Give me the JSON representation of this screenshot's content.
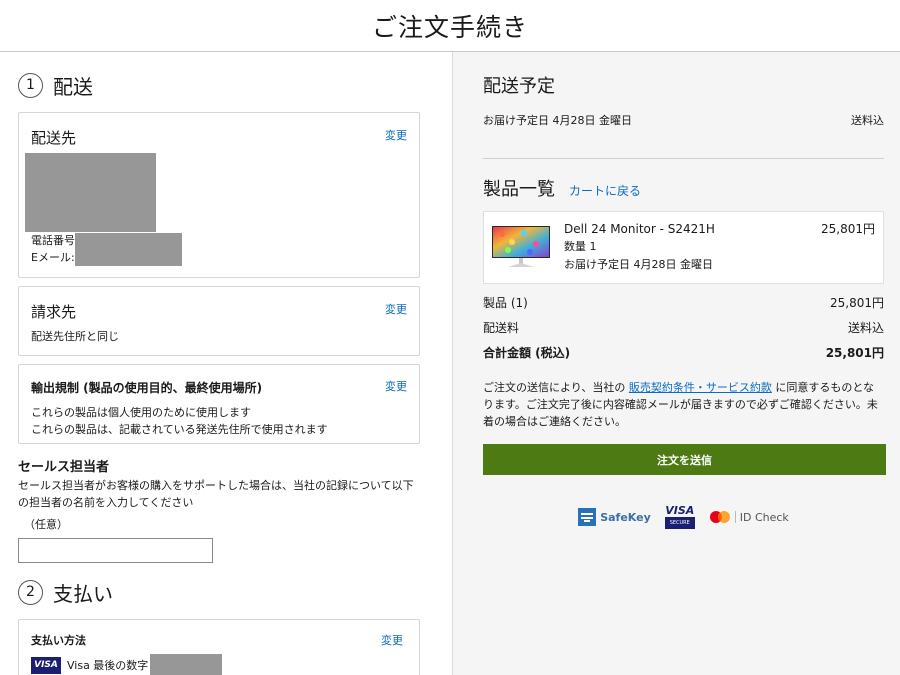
{
  "header": {
    "title": "ご注文手続き"
  },
  "shipping_step": {
    "number": "1",
    "title": "配送",
    "address": {
      "title": "配送先",
      "change": "変更",
      "phone_label": "電話番号",
      "email_label": "Eメール:"
    },
    "billing": {
      "title": "請求先",
      "change": "変更",
      "text": "配送先住所と同じ"
    },
    "export": {
      "title": "輸出規制 (製品の使用目的、最終使用場所)",
      "change": "変更",
      "line1": "これらの製品は個人使用のために使用します",
      "line2": "これらの製品は、記載されている発送先住所で使用されます"
    },
    "sales_rep": {
      "title": "セールス担当者",
      "desc": "セールス担当者がお客様の購入をサポートした場合は、当社の記録について以下の担当者の名前を入力してください",
      "optional": "（任意）",
      "value": ""
    }
  },
  "payment_step": {
    "number": "2",
    "title": "支払い",
    "method_title": "支払い方法",
    "change": "変更",
    "visa_badge": "VISA",
    "card_text": "Visa 最後の数字"
  },
  "delivery": {
    "title": "配送予定",
    "date": "お届け予定日 4月28日 金曜日",
    "shipping": "送料込"
  },
  "products": {
    "title": "製品一覧",
    "back_link": "カートに戻る",
    "items": [
      {
        "name": "Dell 24 Monitor - S2421H",
        "price": "25,801円",
        "qty": "数量 1",
        "delivery": "お届け予定日 4月28日 金曜日"
      }
    ]
  },
  "summary": {
    "products_label": "製品 (1)",
    "products_value": "25,801円",
    "shipping_label": "配送料",
    "shipping_value": "送料込",
    "total_label": "合計金額 (税込)",
    "total_value": "25,801円"
  },
  "terms": {
    "before": "ご注文の送信により、当社の ",
    "link": "販売契約条件・サービス約款",
    "after": " に同意するものとなります。ご注文完了後に内容確認メールが届きますので必ずご確認ください。未着の場合はご連絡ください。"
  },
  "submit_label": "注文を送信",
  "security_logos": {
    "safekey": "SafeKey",
    "visa": "VISA",
    "visa_secure": "SECURE",
    "idcheck": "ID Check"
  },
  "colors": {
    "accent": "#0a6bc2",
    "submit": "#4d7a13",
    "redaction": "#979797"
  }
}
